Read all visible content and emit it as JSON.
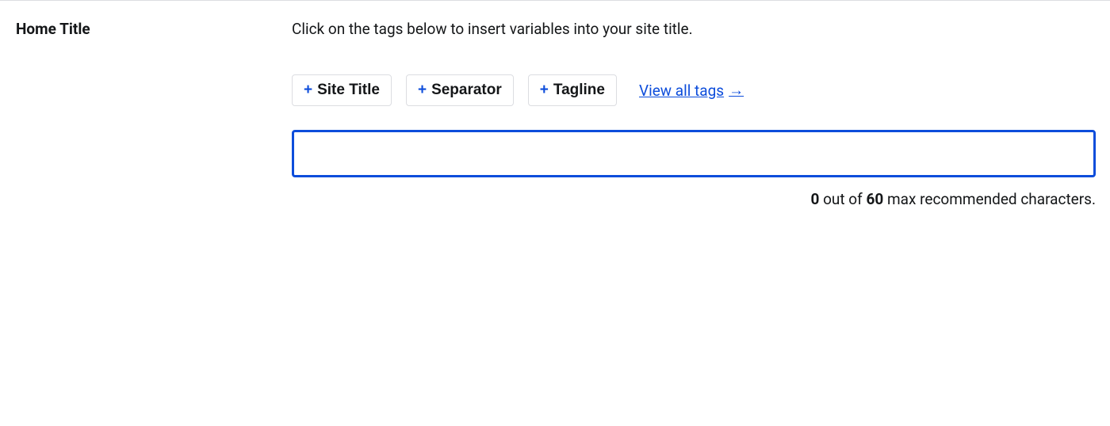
{
  "field": {
    "label": "Home Title",
    "help": "Click on the tags below to insert variables into your site title."
  },
  "tags": {
    "site_title": "Site Title",
    "separator": "Separator",
    "tagline": "Tagline",
    "plus": "+"
  },
  "view_all": {
    "label": "View all tags",
    "arrow": "→"
  },
  "input": {
    "value": "",
    "placeholder": ""
  },
  "counter": {
    "current": "0",
    "mid": " out of ",
    "max": "60",
    "suffix": " max recommended characters."
  }
}
